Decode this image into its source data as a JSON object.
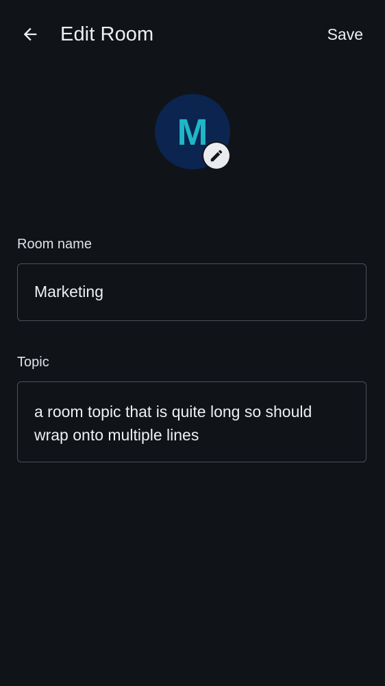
{
  "header": {
    "title": "Edit Room",
    "save_label": "Save",
    "back_icon": "arrow-left-icon"
  },
  "avatar": {
    "initial": "M",
    "background_color": "#0b2450",
    "initial_color": "#1eb7c8",
    "edit_icon": "pencil-icon"
  },
  "form": {
    "room_name": {
      "label": "Room name",
      "value": "Marketing"
    },
    "topic": {
      "label": "Topic",
      "value": "a room topic that is quite long so should wrap onto multiple lines"
    }
  },
  "theme": {
    "background": "#101318",
    "text": "#eef0f3",
    "border": "#4b525a"
  }
}
